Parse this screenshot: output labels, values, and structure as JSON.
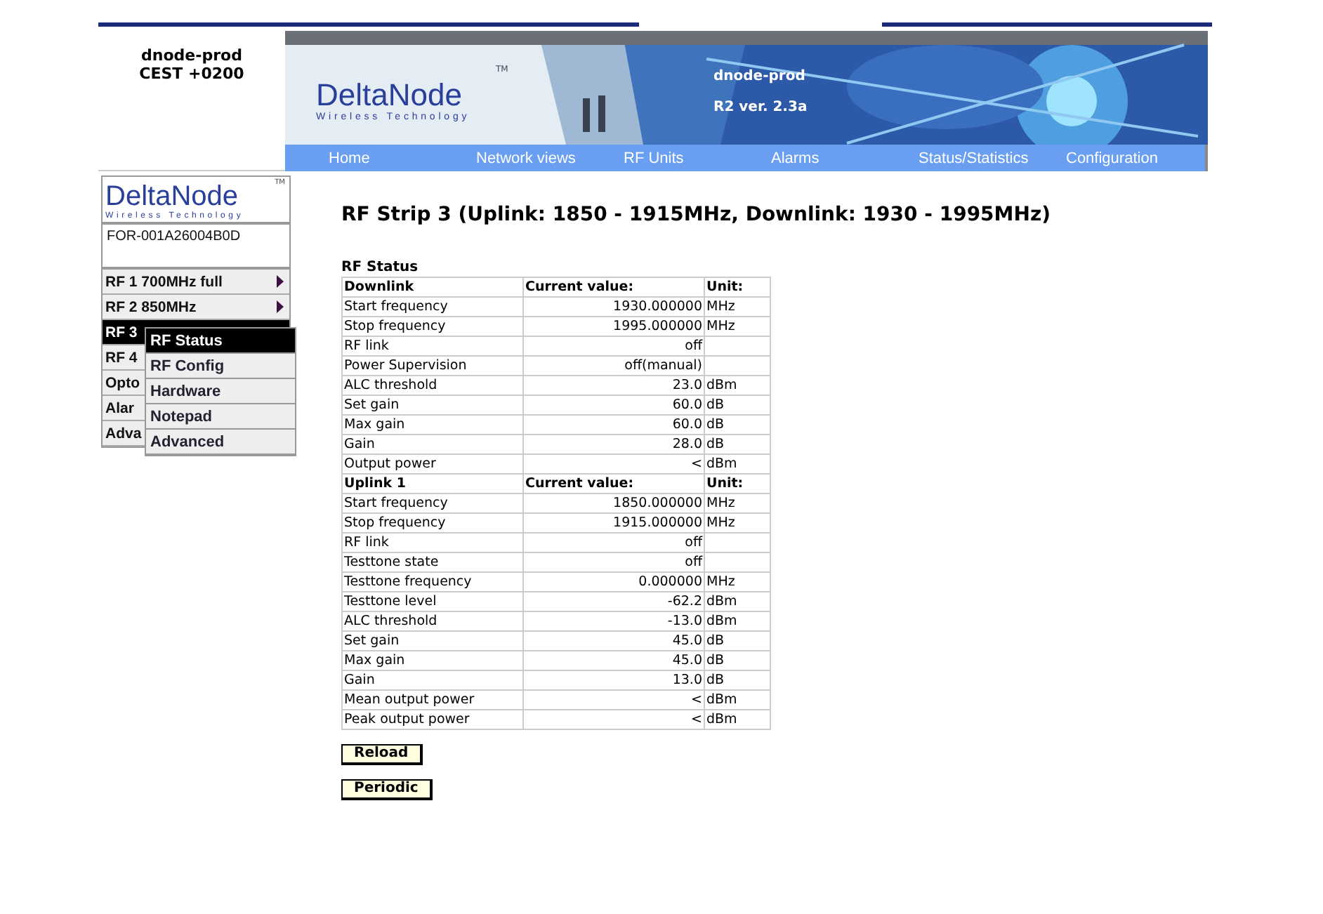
{
  "site_box": {
    "host": "dnode-prod",
    "timezone": "CEST +0200"
  },
  "banner": {
    "logo": "DeltaNode",
    "logo_tagline": "Wireless Technology",
    "logo_mark": "TM",
    "host": "dnode-prod",
    "version": "R2 ver. 2.3a"
  },
  "nav": [
    {
      "label": "Home"
    },
    {
      "label": "Network views"
    },
    {
      "label": "RF Units"
    },
    {
      "label": "Alarms"
    },
    {
      "label": "Status/Statistics"
    },
    {
      "label": "Configuration"
    }
  ],
  "sidebar": {
    "logo": "DeltaNode",
    "logo_tagline": "Wireless Technology",
    "logo_mark": "TM",
    "device_id": "FOR-001A26004B0D",
    "items": [
      {
        "label": "RF 1 700MHz full",
        "selected": false,
        "has_submenu": true
      },
      {
        "label": "RF 2 850MHz",
        "selected": false,
        "has_submenu": true
      },
      {
        "label": "RF 3",
        "selected": true,
        "has_submenu": false
      },
      {
        "label": "RF 4",
        "selected": false,
        "has_submenu": false
      },
      {
        "label": "Opto",
        "selected": false,
        "has_submenu": false
      },
      {
        "label": "Alar",
        "selected": false,
        "has_submenu": false
      },
      {
        "label": "Adva",
        "selected": false,
        "has_submenu": false
      }
    ],
    "submenu": [
      {
        "label": "RF Status",
        "selected": true
      },
      {
        "label": "RF Config",
        "selected": false
      },
      {
        "label": "Hardware",
        "selected": false
      },
      {
        "label": "Notepad",
        "selected": false
      },
      {
        "label": "Advanced",
        "selected": false
      }
    ]
  },
  "page_title": "RF Strip  3 (Uplink:  1850 - 1915MHz, Downlink:  1930 - 1995MHz)",
  "table_title": "RF Status",
  "sections": [
    {
      "header": {
        "label": "Downlink",
        "value": "Current value:",
        "unit": "Unit:"
      },
      "rows": [
        {
          "label": "Start frequency",
          "value": "1930.000000",
          "unit": "MHz"
        },
        {
          "label": "Stop frequency",
          "value": "1995.000000",
          "unit": "MHz"
        },
        {
          "label": "RF link",
          "value": "off"
        },
        {
          "label": "Power Supervision",
          "value": "off(manual)"
        },
        {
          "label": "ALC threshold",
          "value": "23.0",
          "unit": "dBm"
        },
        {
          "label": "Set gain",
          "value": "60.0",
          "unit": "dB"
        },
        {
          "label": "Max gain",
          "value": "60.0",
          "unit": "dB"
        },
        {
          "label": "Gain",
          "value": "28.0",
          "unit": "dB"
        },
        {
          "label": "Output power",
          "value": "<",
          "unit": "dBm"
        }
      ]
    },
    {
      "header": {
        "label": "Uplink 1",
        "value": "Current value:",
        "unit": "Unit:"
      },
      "rows": [
        {
          "label": "Start frequency",
          "value": "1850.000000",
          "unit": "MHz"
        },
        {
          "label": "Stop frequency",
          "value": "1915.000000",
          "unit": "MHz"
        },
        {
          "label": "RF link",
          "value": "off"
        },
        {
          "label": "Testtone state",
          "value": "off"
        },
        {
          "label": "Testtone frequency",
          "value": "0.000000",
          "unit": "MHz"
        },
        {
          "label": "Testtone level",
          "value": "-62.2",
          "unit": "dBm"
        },
        {
          "label": "ALC threshold",
          "value": "-13.0",
          "unit": "dBm"
        },
        {
          "label": "Set gain",
          "value": "45.0",
          "unit": "dB"
        },
        {
          "label": "Max gain",
          "value": "45.0",
          "unit": "dB"
        },
        {
          "label": "Gain",
          "value": "13.0",
          "unit": "dB"
        },
        {
          "label": "Mean output power",
          "value": "<",
          "unit": "dBm"
        },
        {
          "label": "Peak output power",
          "value": "<",
          "unit": "dBm"
        }
      ]
    }
  ],
  "buttons": [
    {
      "label": "Reload"
    },
    {
      "label": "Periodic"
    }
  ]
}
